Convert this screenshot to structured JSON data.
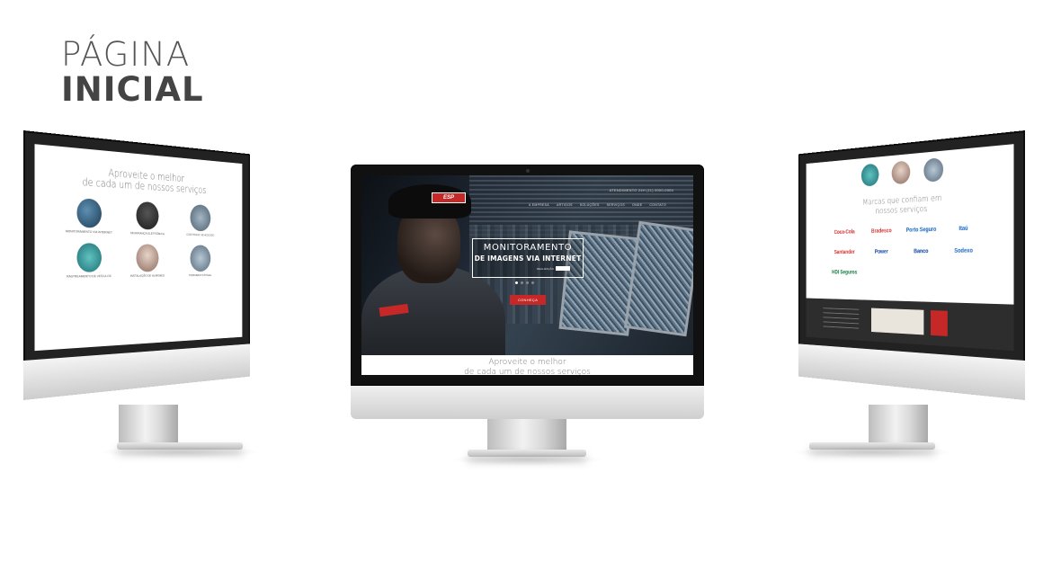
{
  "heading": {
    "line1": "PÁGINA",
    "line2": "INICIAL"
  },
  "center": {
    "logo_text": "ESP",
    "topbar_text": "ATENDIMENTO 24H (11) 0000-0000",
    "nav": [
      "A EMPRESA",
      "ARTIGOS",
      "SOLUÇÕES",
      "SERVIÇOS",
      "ONDE",
      "CONTATO"
    ],
    "banner_line1": "MONITORAMENTO",
    "banner_line2": "DE IMAGENS VIA INTERNET",
    "realization_label": "REALIZAÇÃO",
    "cta_label": "CONHEÇA",
    "section_line1": "Aproveite o melhor",
    "section_line2": "de cada um de nossos serviços"
  },
  "left": {
    "title_line1": "Aproveite o melhor",
    "title_line2": "de cada um de nossos serviços",
    "services": [
      "MONITORAMENTO VIA INTERNET",
      "SEGURANÇA ELETRÔNICA",
      "CONTROLE DE ACESSO",
      "RASTREAMENTO DE VEÍCULOS",
      "INSTALAÇÃO DE ALARMES",
      "PORTARIA VIRTUAL"
    ]
  },
  "right": {
    "title_line1": "Marcas que confiam em",
    "title_line2": "nossos serviços",
    "clients": [
      {
        "name": "Coca-Cola",
        "color": "#d32f2f"
      },
      {
        "name": "Bradesco",
        "color": "#d32f2f"
      },
      {
        "name": "Porto Seguro",
        "color": "#1565c0"
      },
      {
        "name": "Itaú",
        "color": "#1565c0"
      },
      {
        "name": "Santander",
        "color": "#d32f2f"
      },
      {
        "name": "Power",
        "color": "#0d47a1"
      },
      {
        "name": "Banco",
        "color": "#0d47a1"
      },
      {
        "name": "Sodexo",
        "color": "#1565c0"
      },
      {
        "name": "HDI Seguros",
        "color": "#0d7a3e"
      }
    ]
  },
  "colors": {
    "accent": "#c62828",
    "dark": "#111111"
  }
}
